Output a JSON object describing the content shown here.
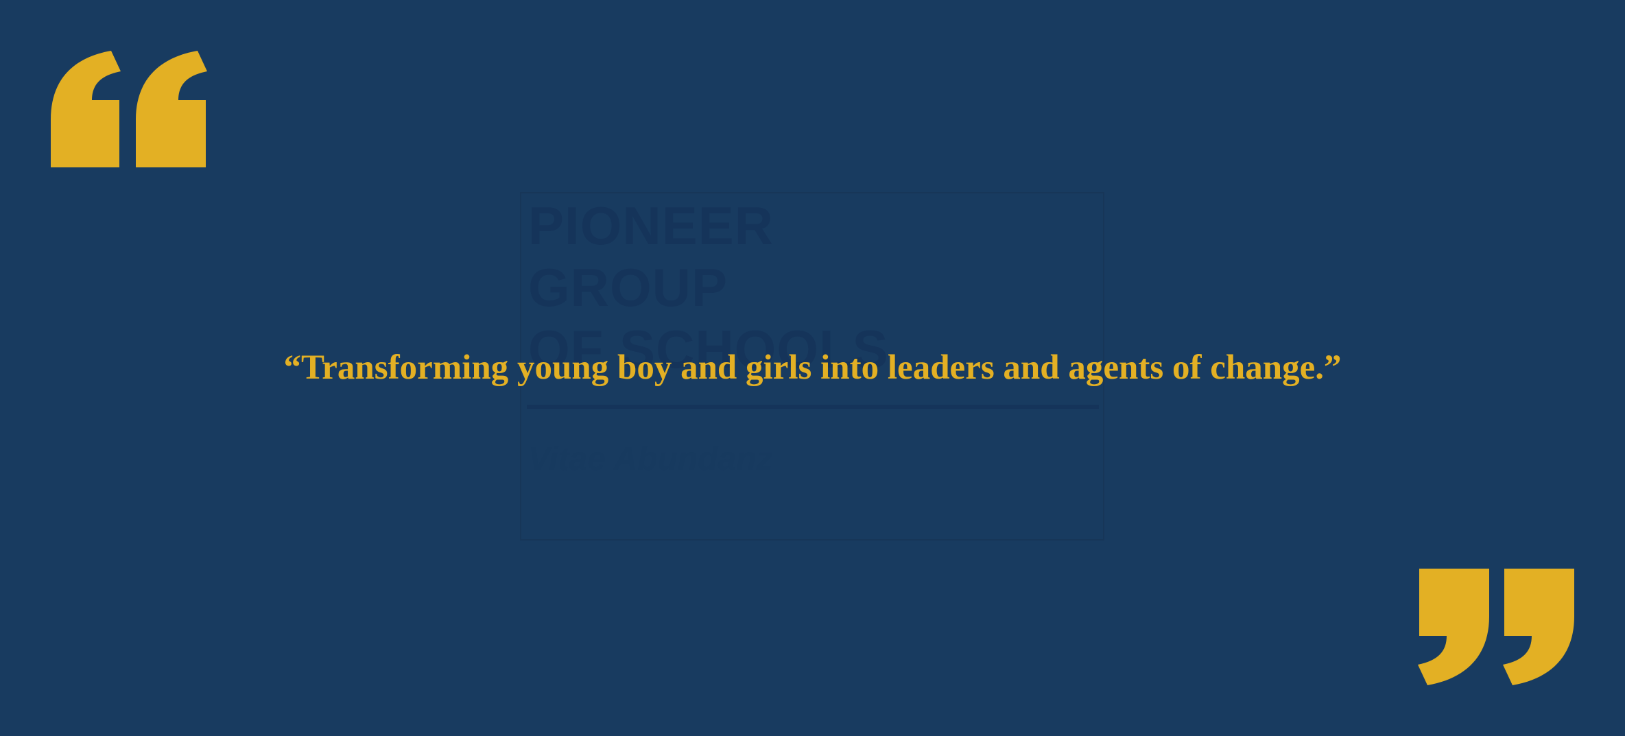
{
  "colors": {
    "background": "#183b60",
    "accent": "#e3b024",
    "watermark": "#15345a"
  },
  "icons": {
    "open_quote": "open-quote-icon",
    "close_quote": "close-quote-icon",
    "logo": "school-logo-watermark"
  },
  "watermark": {
    "title": "PIONEER\nGROUP\nOF SCHOOLS",
    "motto": "Vitae Abundanz"
  },
  "quote": {
    "text": "“Transforming young boy and girls into leaders and agents of change.”"
  }
}
